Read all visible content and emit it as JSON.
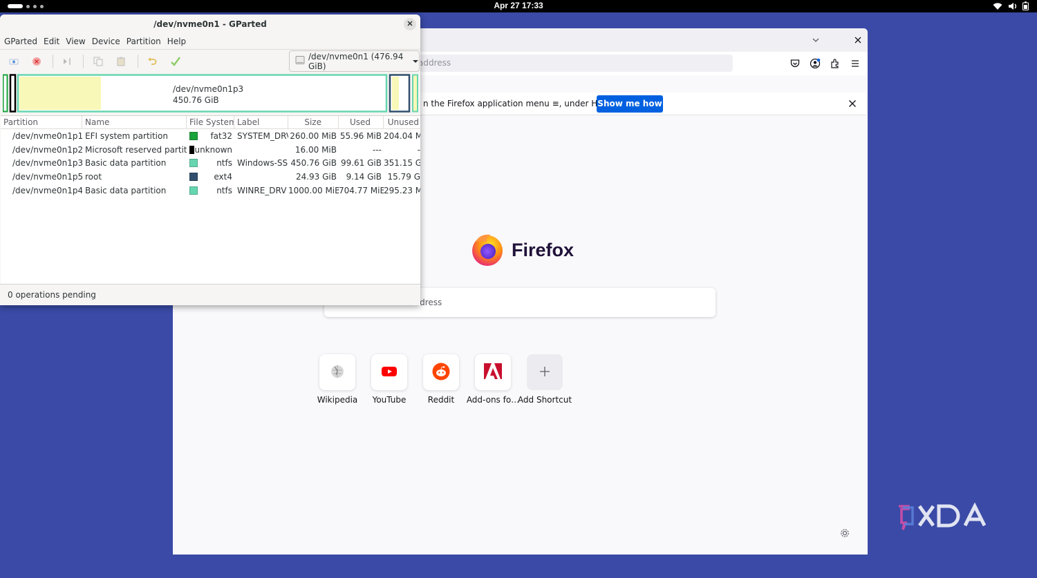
{
  "topbar": {
    "clock": "Apr 27  17:33"
  },
  "firefox": {
    "url_placeholder": "address",
    "notice_text": "n the Firefox application menu ≡, under History.",
    "notice_button": "Show me how",
    "brand": "Firefox",
    "search_placeholder": "e or enter address",
    "shortcuts": [
      {
        "label": "Wikipedia",
        "icon": "wikipedia-icon"
      },
      {
        "label": "YouTube",
        "icon": "youtube-icon"
      },
      {
        "label": "Reddit",
        "icon": "reddit-icon"
      },
      {
        "label": "Add-ons fo…",
        "icon": "addons-icon"
      },
      {
        "label": "Add Shortcut",
        "icon": "plus-icon"
      }
    ]
  },
  "gparted": {
    "title": "/dev/nvme0n1 - GParted",
    "menus": [
      "GParted",
      "Edit",
      "View",
      "Device",
      "Partition",
      "Help"
    ],
    "device_selector": "/dev/nvme0n1 (476.94 GiB)",
    "graph": {
      "selected_name": "/dev/nvme0n1p3",
      "selected_size": "450.76 GiB"
    },
    "columns": [
      "Partition",
      "Name",
      "File System",
      "Label",
      "Size",
      "Used",
      "Unused"
    ],
    "rows": [
      {
        "partition": "/dev/nvme0n1p1",
        "name": "EFI system partition",
        "fs": "fat32",
        "fs_color": "#18a23a",
        "label": "SYSTEM_DRV",
        "size": "260.00 MiB",
        "used": "55.96 MiB",
        "unused": "204.04 M",
        "warning": false
      },
      {
        "partition": "/dev/nvme0n1p2",
        "name": "Microsoft reserved partition",
        "fs": "unknown",
        "fs_color": "#000000",
        "label": "",
        "size": "16.00 MiB",
        "used": "---",
        "unused": "-",
        "warning": true
      },
      {
        "partition": "/dev/nvme0n1p3",
        "name": "Basic data partition",
        "fs": "ntfs",
        "fs_color": "#66d6b0",
        "label": "Windows-SSD",
        "size": "450.76 GiB",
        "used": "99.61 GiB",
        "unused": "351.15 G",
        "warning": false
      },
      {
        "partition": "/dev/nvme0n1p5",
        "name": "root",
        "fs": "ext4",
        "fs_color": "#314e6c",
        "label": "",
        "size": "24.93 GiB",
        "used": "9.14 GiB",
        "unused": "15.79 G",
        "warning": false
      },
      {
        "partition": "/dev/nvme0n1p4",
        "name": "Basic data partition",
        "fs": "ntfs",
        "fs_color": "#66d6b0",
        "label": "WINRE_DRV",
        "size": "1000.00 MiB",
        "used": "704.77 MiB",
        "unused": "295.23 M",
        "warning": false
      }
    ],
    "status": "0 operations pending"
  },
  "colors": {
    "desktop": "#3a4aa6",
    "accent_blue": "#0061e0",
    "ntfs": "#66d6b0",
    "used_fill": "#f8f8b8"
  }
}
